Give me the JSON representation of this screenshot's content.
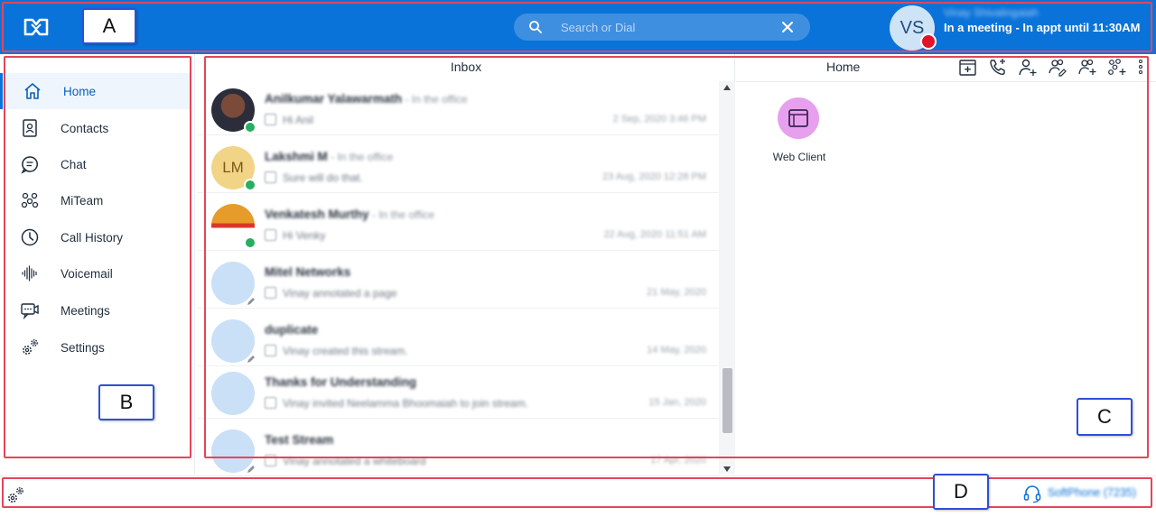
{
  "header": {
    "logo": "mitel-logo-icon",
    "search": {
      "placeholder": "Search or Dial"
    },
    "user": {
      "initials": "VS",
      "name": "Vinay Shivalingaiah",
      "status": "In a meeting - In appt until 11:30AM",
      "presence_color": "#e0142b"
    }
  },
  "sidebar": {
    "items": [
      {
        "label": "Home",
        "icon": "home-icon",
        "active": true
      },
      {
        "label": "Contacts",
        "icon": "contacts-book-icon"
      },
      {
        "label": "Chat",
        "icon": "chat-bubble-icon"
      },
      {
        "label": "MiTeam",
        "icon": "team-icon"
      },
      {
        "label": "Call History",
        "icon": "clock-icon"
      },
      {
        "label": "Voicemail",
        "icon": "voicemail-wave-icon"
      },
      {
        "label": "Meetings",
        "icon": "meetings-icon"
      },
      {
        "label": "Settings",
        "icon": "gears-icon"
      }
    ],
    "collapse_icon": "chevron-left-icon"
  },
  "inbox": {
    "title": "Inbox",
    "conversations": [
      {
        "name": "Anilkumar Yalawarmath",
        "presence": " - In the office",
        "preview": "Hi Anil",
        "date": "2 Sep, 2020 3:46 PM"
      },
      {
        "name": "Lakshmi M",
        "presence": " - In the office",
        "initials": "LM",
        "preview": "Sure will do that.",
        "date": "23 Aug, 2020 12:28 PM"
      },
      {
        "name": "Venkatesh Murthy",
        "presence": " - In the office",
        "preview": "Hi Venky",
        "date": "22 Aug, 2020 11:51 AM"
      },
      {
        "name": "Mitel Networks",
        "presence": "",
        "preview": "Vinay annotated a page",
        "date": "21 May, 2020"
      },
      {
        "name": "duplicate",
        "presence": "",
        "preview": "Vinay created this stream.",
        "date": "14 May, 2020"
      },
      {
        "name": "Thanks for Understanding",
        "presence": "",
        "preview": "Vinay invited Neelamma Bhoomaiah to join stream.",
        "date": "15 Jan, 2020"
      },
      {
        "name": "Test Stream",
        "presence": "",
        "preview": "Vinay annotated a whiteboard",
        "date": "17 Apr, 2020"
      }
    ]
  },
  "home": {
    "title": "Home",
    "toolbar_icons": [
      "add-widget-icon",
      "add-call-icon",
      "add-contact-icon",
      "add-group-chat-icon",
      "add-user-icon",
      "add-team-icon",
      "more-vertical-icon"
    ],
    "apps": [
      {
        "label": "Web Client",
        "icon": "browser-window-icon"
      }
    ]
  },
  "statusbar": {
    "settings_icon": "gears-icon",
    "softphone": {
      "icon": "headset-icon",
      "label": "SoftPhone (7235)"
    }
  },
  "annotations": {
    "a": "A",
    "b": "B",
    "c": "C",
    "d": "D"
  },
  "colors": {
    "header_bg": "#0a73d9",
    "annotation_border": "#e3465a",
    "callout_border": "#2f4fd8",
    "online": "#27ae60"
  }
}
